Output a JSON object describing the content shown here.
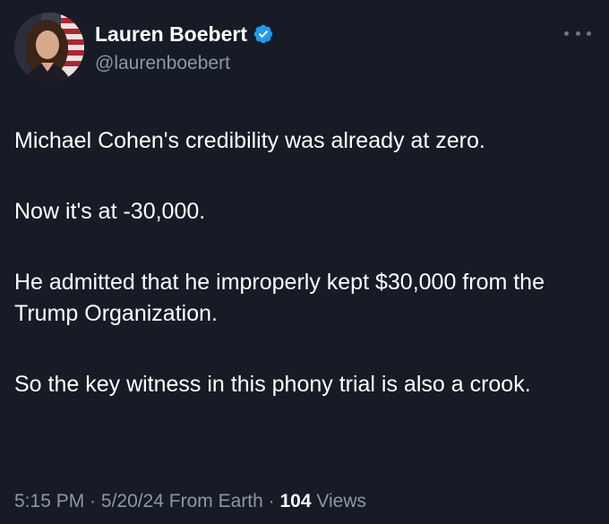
{
  "author": {
    "display_name": "Lauren Boebert",
    "handle": "@laurenboebert",
    "verified": true,
    "verified_color": "#1d9bf0"
  },
  "tweet": {
    "paragraphs": [
      "Michael Cohen's credibility was already at zero.",
      "Now it's at -30,000.",
      "He admitted that he improperly kept $30,000 from the Trump Organization.",
      "So the key witness in this phony trial is also a crook."
    ]
  },
  "meta": {
    "time": "5:15 PM",
    "sep1": " · ",
    "date": "5/20/24",
    "source": " From Earth",
    "sep2": " · ",
    "views_count": "104",
    "views_label": " Views"
  },
  "icons": {
    "more": "more-horizontal-icon",
    "verified": "verified-badge-icon"
  }
}
